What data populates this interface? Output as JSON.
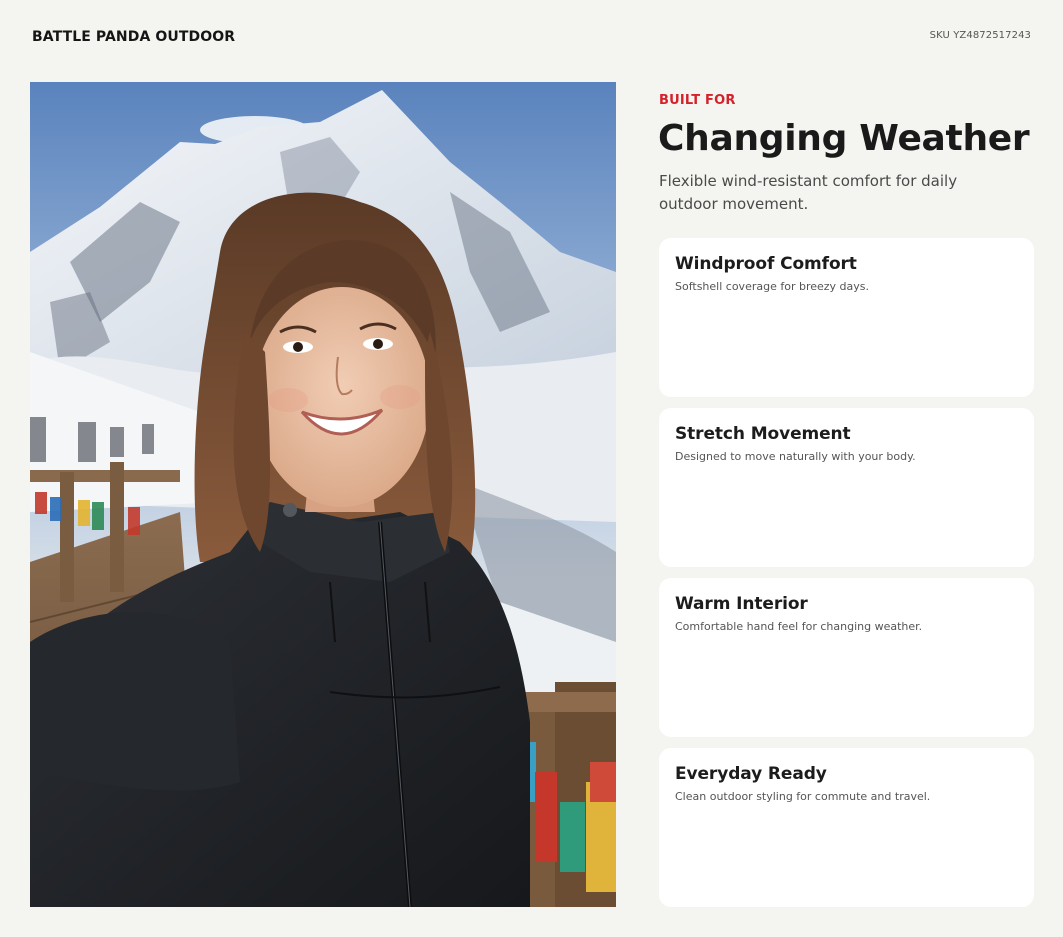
{
  "header": {
    "brand": "BATTLE PANDA OUTDOOR",
    "sku": "SKU YZ4872517243"
  },
  "hero": {
    "eyebrow": "BUILT FOR",
    "title": "Changing Weather",
    "subtitle": "Flexible wind-resistant comfort for daily outdoor movement."
  },
  "features": [
    {
      "title": "Windproof Comfort",
      "description": "Softshell coverage for breezy days."
    },
    {
      "title": "Stretch Movement",
      "description": "Designed to move naturally with your body."
    },
    {
      "title": "Warm Interior",
      "description": "Comfortable hand feel for changing weather."
    },
    {
      "title": "Everyday Ready",
      "description": "Clean outdoor styling for commute and travel."
    }
  ],
  "colors": {
    "background": "#f4f4f0",
    "accent": "#d5212b",
    "card": "#ffffff",
    "jacket": "#22252a"
  },
  "photo": {
    "icon": "mountain-selfie-photo"
  }
}
